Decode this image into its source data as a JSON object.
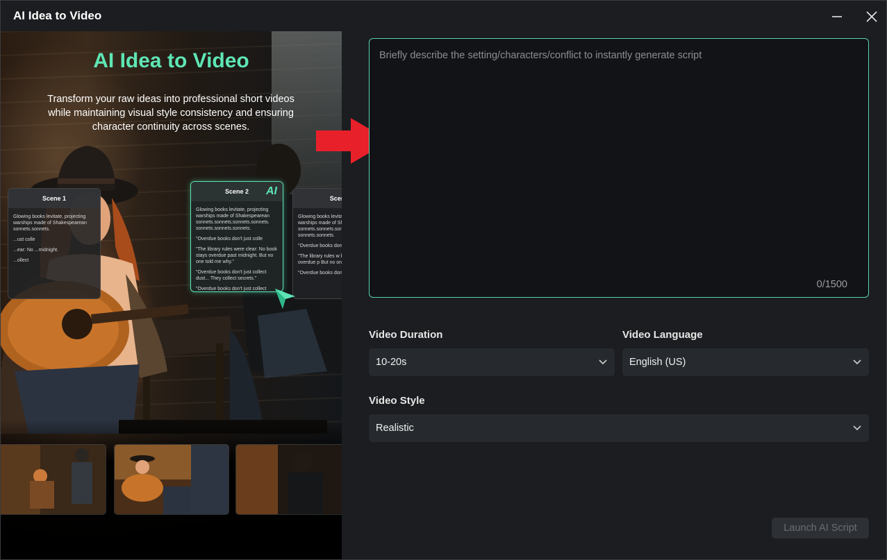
{
  "window": {
    "title": "AI Idea to Video"
  },
  "preview": {
    "title": "AI Idea to Video",
    "description": "Transform your raw ideas into professional short videos while maintaining visual style consistency and ensuring character continuity across scenes.",
    "ai_badge": "AI",
    "scene_cards": [
      {
        "label": "Scene 1",
        "lines": [
          "Glowing books levitate, projecting warships made of Shakespearean sonnets.sonnets.",
          "...ust colle",
          "...ear: No ...midnight.",
          "...ollect"
        ]
      },
      {
        "label": "Scene 2",
        "lines": [
          "Glowing books levitate, projecting warships made of Shakespearean sonnets.sonnets.sonnets.sonnets. sonnets.sonnets.sonnets.",
          "\"Overdue books don't just colle",
          "\"The library rules were clear: No book stays overdue past midnight. But no one told me why.\"",
          "\"Overdue books don't just collect dust... They collect secrets.\"",
          "\"Overdue books don't just collect dust\""
        ]
      },
      {
        "label": "Scene",
        "lines": [
          "Glowing books levitate, projecting warships made of Shakespearean sonnets.sonnets.sonnets. sonnets.sonnets.",
          "\"Overdue books don'",
          "\"The library rules w book stays overdue p But no one told me w",
          "\"Overdue books don'"
        ]
      }
    ]
  },
  "prompt": {
    "placeholder": "Briefly describe the setting/characters/conflict to instantly generate script",
    "value": "",
    "counter": "0/1500"
  },
  "fields": {
    "duration": {
      "label": "Video Duration",
      "value": "10-20s"
    },
    "language": {
      "label": "Video Language",
      "value": "English (US)"
    },
    "style": {
      "label": "Video Style",
      "value": "Realistic"
    }
  },
  "actions": {
    "launch_label": "Launch AI Script"
  },
  "colors": {
    "accent": "#5ee6b5",
    "arrow": "#e8202a",
    "background": "#1b1d20"
  }
}
